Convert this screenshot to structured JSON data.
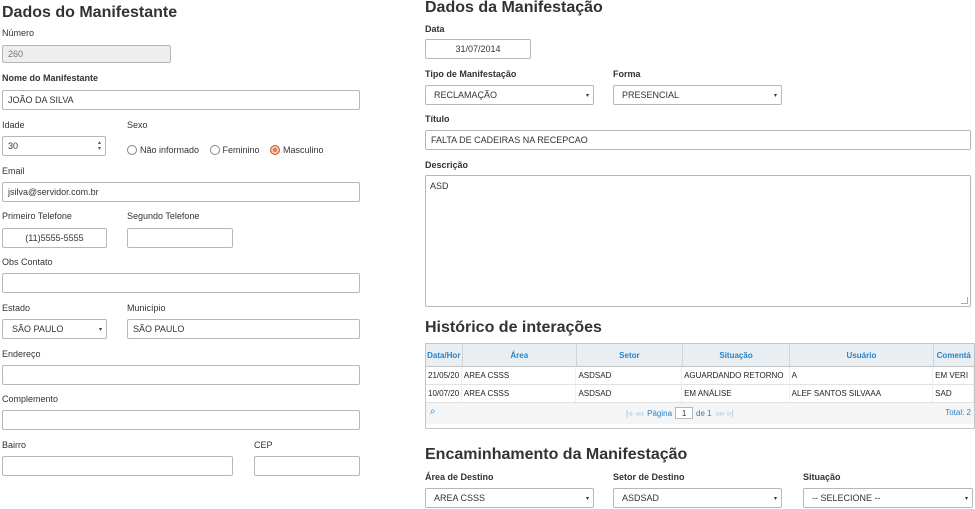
{
  "manifestante": {
    "title": "Dados do Manifestante",
    "numero_label": "Número",
    "numero_value": "260",
    "nome_label": "Nome do Manifestante",
    "nome_value": "JOÃO DA SILVA",
    "idade_label": "Idade",
    "idade_value": "30",
    "sexo_label": "Sexo",
    "sexo_options": [
      "Não informado",
      "Feminino",
      "Masculino"
    ],
    "sexo_selected": "Masculino",
    "email_label": "Email",
    "email_value": "jsilva@servidor.com.br",
    "tel1_label": "Primeiro Telefone",
    "tel1_value": "(11)5555-5555",
    "tel2_label": "Segundo Telefone",
    "tel2_value": "",
    "obs_label": "Obs Contato",
    "obs_value": "",
    "estado_label": "Estado",
    "estado_value": "SÃO PAULO",
    "municipio_label": "Município",
    "municipio_value": "SÃO PAULO",
    "endereco_label": "Endereço",
    "endereco_value": "",
    "complemento_label": "Complemento",
    "complemento_value": "",
    "bairro_label": "Bairro",
    "bairro_value": "",
    "cep_label": "CEP",
    "cep_value": ""
  },
  "manifestacao": {
    "title": "Dados da Manifestação",
    "data_label": "Data",
    "data_value": "31/07/2014",
    "tipo_label": "Tipo de Manifestação",
    "tipo_value": "RECLAMAÇÃO",
    "forma_label": "Forma",
    "forma_value": "PRESENCIAL",
    "titulo_label": "Título",
    "titulo_value": "FALTA DE CADEIRAS NA RECEPCAO",
    "descricao_label": "Descrição",
    "descricao_value": "ASD"
  },
  "historico": {
    "title": "Histórico de interações",
    "columns": [
      "Data/Hor",
      "Área",
      "Setor",
      "Situação",
      "Usuário",
      "Comentá"
    ],
    "rows": [
      [
        "21/05/20",
        "AREA CSSS",
        "ASDSAD",
        "AGUARDANDO RETORNO",
        "A",
        "EM VERI"
      ],
      [
        "10/07/20",
        "AREA CSSS",
        "ASDSAD",
        "EM ANÁLISE",
        "ALEF SANTOS SILVAAA",
        "SAD"
      ]
    ],
    "pager_first": "|◃",
    "pager_prev": "◃◃",
    "pager_page_label": "Página",
    "pager_page_value": "1",
    "pager_of": "de 1",
    "pager_next": "▹▹",
    "pager_last": "▹|",
    "total": "Total: 2"
  },
  "encaminhamento": {
    "title": "Encaminhamento da Manifestação",
    "area_label": "Área de Destino",
    "area_value": "AREA CSSS",
    "setor_label": "Setor de Destino",
    "setor_value": "ASDSAD",
    "situacao_label": "Situação",
    "situacao_value": "-- SELECIONE --"
  },
  "icons": {
    "select_arrow": "▾",
    "spin_up": "▴",
    "spin_down": "▾",
    "search": "⌕"
  }
}
